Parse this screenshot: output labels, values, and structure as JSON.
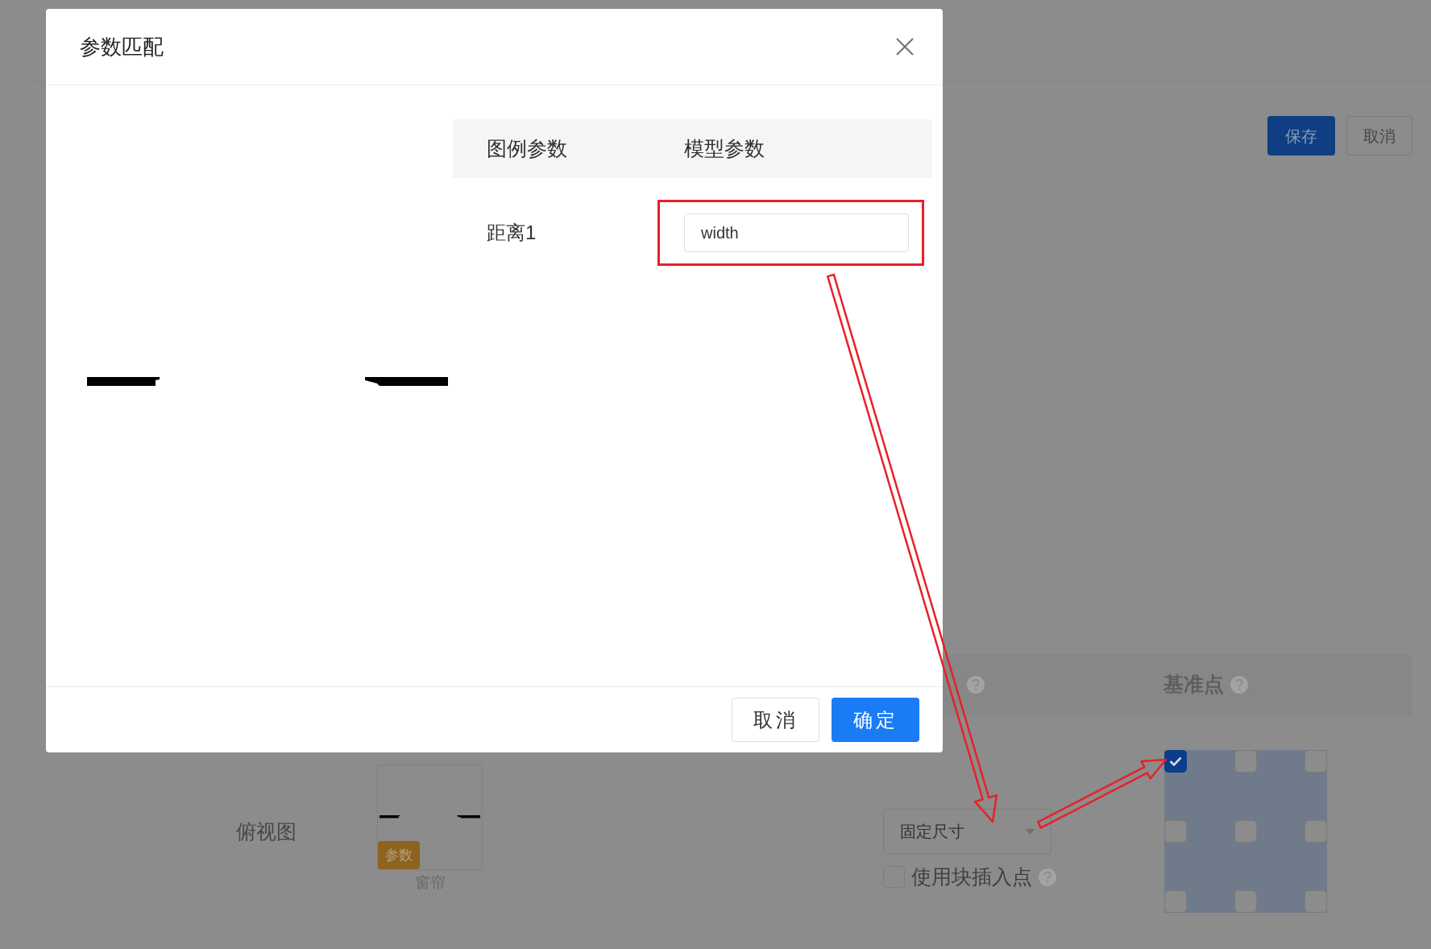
{
  "background_page": {
    "actions": [
      {
        "label": "保存",
        "kind": "primary"
      },
      {
        "label": "取消",
        "kind": "default"
      }
    ],
    "settings_header": [
      {
        "help": true
      },
      {
        "label": "基准点",
        "help": true
      }
    ],
    "size_mode_select": {
      "value": "固定尺寸"
    },
    "use_block_insert_point": {
      "label": "使用块插入点",
      "checked": false,
      "help": true
    },
    "base_point_grid": [
      {
        "selected": true
      },
      {
        "selected": false
      },
      {
        "selected": false
      },
      {
        "selected": false
      },
      {
        "selected": false
      },
      {
        "selected": false
      },
      {
        "selected": false
      },
      {
        "selected": false
      },
      {
        "selected": false
      }
    ],
    "top_view": {
      "label": "俯视图",
      "badge": "参数",
      "caption": "窗帘"
    }
  },
  "dialog": {
    "title": "参数匹配",
    "columns": [
      "图例参数",
      "模型参数"
    ],
    "rows": [
      {
        "legend_param": "距离1",
        "model_param": "width",
        "highlighted": true
      }
    ],
    "buttons": [
      {
        "label": "取消",
        "kind": "default"
      },
      {
        "label": "确定",
        "kind": "primary"
      }
    ]
  }
}
